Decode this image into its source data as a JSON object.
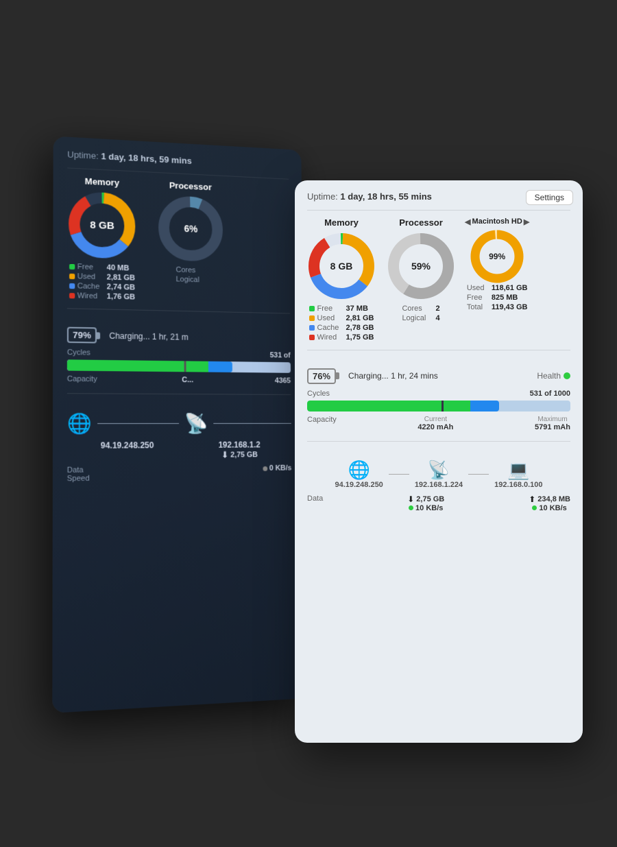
{
  "dark_card": {
    "uptime_label": "Uptime:",
    "uptime_value": "1 day, 18 hrs, 59 mins",
    "memory_title": "Memory",
    "memory_size": "8 GB",
    "processor_title": "Processor",
    "processor_pct": "6%",
    "legend": [
      {
        "label": "Free",
        "value": "40 MB",
        "color": "#22cc44"
      },
      {
        "label": "Used",
        "value": "2,81 GB",
        "color": "#f0a000"
      },
      {
        "label": "Cache",
        "value": "2,74 GB",
        "color": "#4488ee"
      },
      {
        "label": "Wired",
        "value": "1,76 GB",
        "color": "#dd3322"
      }
    ],
    "proc_cores_label": "Cores",
    "proc_logical_label": "Logical",
    "battery_pct": "79%",
    "charging_text": "Charging... 1 hr, 21 m",
    "cycles_label": "Cycles",
    "cycles_value": "531 of",
    "capacity_label": "Capacity",
    "capacity_value": "4365",
    "network_ip1": "94.19.248.250",
    "network_ip2": "192.168.1.2",
    "data_label": "Data",
    "data_value": "2,75 GB",
    "speed_label": "Speed",
    "speed_value": "0 KB/s"
  },
  "light_card": {
    "uptime_label": "Uptime:",
    "uptime_value": "1 day, 18 hrs, 55 mins",
    "settings_btn": "Settings",
    "memory_title": "Memory",
    "memory_size": "8 GB",
    "processor_title": "Processor",
    "processor_pct": "59%",
    "hd_title": "Macintosh HD",
    "hd_used_label": "Used",
    "hd_used_value": "118,61 GB",
    "hd_free_label": "Free",
    "hd_free_value": "825 MB",
    "hd_total_label": "Total",
    "hd_total_value": "119,43 GB",
    "hd_pct": "99%",
    "legend": [
      {
        "label": "Free",
        "value": "37 MB",
        "color": "#22cc44"
      },
      {
        "label": "Used",
        "value": "2,81 GB",
        "color": "#f0a000"
      },
      {
        "label": "Cache",
        "value": "2,78 GB",
        "color": "#4488ee"
      },
      {
        "label": "Wired",
        "value": "1,75 GB",
        "color": "#dd3322"
      }
    ],
    "proc_cores_label": "Cores",
    "proc_cores_val": "2",
    "proc_logical_label": "Logical",
    "proc_logical_val": "4",
    "battery_pct": "76%",
    "charging_text": "Charging... 1 hr, 24 mins",
    "health_label": "Health",
    "cycles_label": "Cycles",
    "cycles_value": "531 of 1000",
    "capacity_label": "Capacity",
    "current_label": "Current",
    "current_value": "4220 mAh",
    "maximum_label": "Maximum",
    "maximum_value": "5791 mAh",
    "network_ip1": "94.19.248.250",
    "network_ip2": "192.168.1.224",
    "network_ip3": "192.168.0.100",
    "data_label": "Data",
    "data_value": "2,75 GB",
    "data_speed": "10 KB/s",
    "upload_value": "234,8 MB",
    "upload_speed": "10 KB/s"
  }
}
